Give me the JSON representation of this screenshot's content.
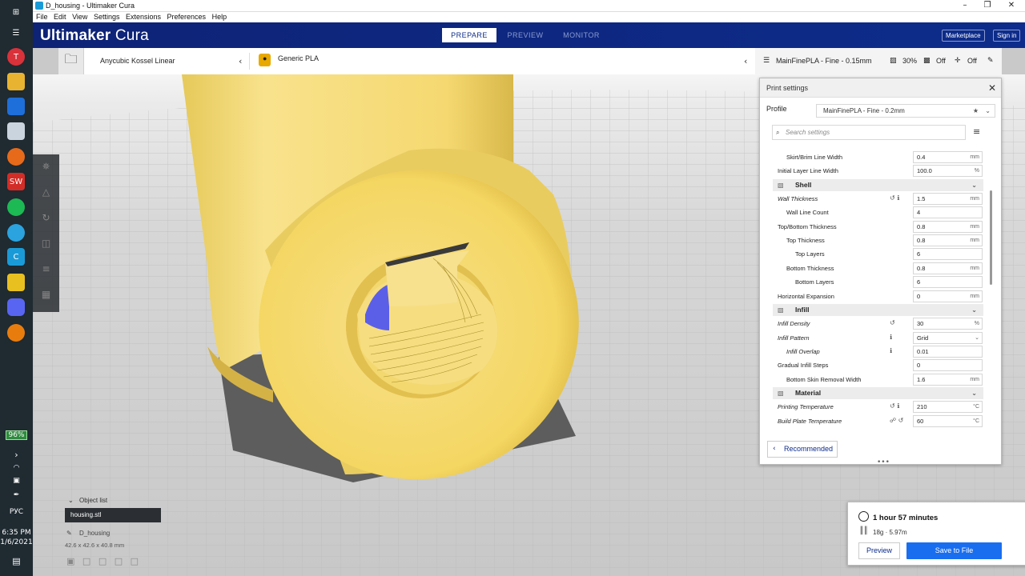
{
  "window": {
    "title": "D_housing - Ultimaker Cura",
    "minimize": "–",
    "maximize": "❐",
    "close": "✕"
  },
  "menubar": [
    "File",
    "Edit",
    "View",
    "Settings",
    "Extensions",
    "Preferences",
    "Help"
  ],
  "header": {
    "brand": "Ultimaker",
    "brand_suffix": "Cura",
    "stages": [
      "PREPARE",
      "PREVIEW",
      "MONITOR"
    ],
    "active_stage": "PREPARE",
    "marketplace": "Marketplace",
    "sign_in": "Sign in"
  },
  "toolbar": {
    "printer": "Anycubic Kossel Linear",
    "material": "Generic PLA",
    "profile_summary": "MainFinePLA - Fine - 0.15mm",
    "infill_pct": "30%",
    "support": "Off",
    "adhesion": "Off"
  },
  "print_settings": {
    "title": "Print settings",
    "profile_label": "Profile",
    "profile_value": "MainFinePLA - Fine - 0.2mm",
    "search_placeholder": "Search settings",
    "rows": [
      {
        "label": "Skirt/Brim Line Width",
        "value": "0.4",
        "unit": "mm",
        "indent": 1,
        "italic": false,
        "icons": ""
      },
      {
        "label": "Initial Layer Line Width",
        "value": "100.0",
        "unit": "%",
        "indent": 0,
        "italic": false,
        "icons": ""
      },
      {
        "category": "Shell"
      },
      {
        "label": "Wall Thickness",
        "value": "1.5",
        "unit": "mm",
        "indent": 0,
        "italic": true,
        "icons": "↺ ℹ"
      },
      {
        "label": "Wall Line Count",
        "value": "4",
        "unit": "",
        "indent": 1,
        "italic": false,
        "icons": ""
      },
      {
        "label": "Top/Bottom Thickness",
        "value": "0.8",
        "unit": "mm",
        "indent": 0,
        "italic": false,
        "icons": ""
      },
      {
        "label": "Top Thickness",
        "value": "0.8",
        "unit": "mm",
        "indent": 1,
        "italic": false,
        "icons": ""
      },
      {
        "label": "Top Layers",
        "value": "6",
        "unit": "",
        "indent": 2,
        "italic": false,
        "icons": ""
      },
      {
        "label": "Bottom Thickness",
        "value": "0.8",
        "unit": "mm",
        "indent": 1,
        "italic": false,
        "icons": ""
      },
      {
        "label": "Bottom Layers",
        "value": "6",
        "unit": "",
        "indent": 2,
        "italic": false,
        "icons": ""
      },
      {
        "label": "Horizontal Expansion",
        "value": "0",
        "unit": "mm",
        "indent": 0,
        "italic": false,
        "icons": ""
      },
      {
        "category": "Infill"
      },
      {
        "label": "Infill Density",
        "value": "30",
        "unit": "%",
        "indent": 0,
        "italic": true,
        "icons": "↺"
      },
      {
        "label": "Infill Pattern",
        "value": "Grid",
        "unit": "⌄",
        "indent": 0,
        "italic": true,
        "icons": "ℹ"
      },
      {
        "label": "Infill Overlap",
        "value": "0.01",
        "unit": "",
        "indent": 1,
        "italic": true,
        "icons": "ℹ"
      },
      {
        "label": "Gradual Infill Steps",
        "value": "0",
        "unit": "",
        "indent": 0,
        "italic": false,
        "icons": ""
      },
      {
        "label": "Bottom Skin Removal Width",
        "value": "1.6",
        "unit": "mm",
        "indent": 1,
        "italic": false,
        "icons": ""
      },
      {
        "category": "Material"
      },
      {
        "label": "Printing Temperature",
        "value": "210",
        "unit": "°C",
        "indent": 0,
        "italic": true,
        "icons": "↺ ℹ"
      },
      {
        "label": "Build Plate Temperature",
        "value": "60",
        "unit": "°C",
        "indent": 0,
        "italic": true,
        "icons": "☍ ↺"
      }
    ],
    "recommended_btn": "Recommended"
  },
  "action_panel": {
    "time": "1 hour 57 minutes",
    "material": "18g · 5.97m",
    "preview_btn": "Preview",
    "save_btn": "Save to File"
  },
  "object_list": {
    "header": "Object list",
    "item": "housing.stl",
    "name": "D_housing",
    "dimensions": "42.6 x 42.6 x 40.8 mm"
  },
  "taskbar": {
    "battery": "96%",
    "lang": "РУС",
    "time": "6:35 PM",
    "date": "1/6/2021"
  },
  "colors": {
    "header_blue": "#0d2c8b",
    "accent_blue": "#196ef0",
    "model_yellow": "#f9dc6b"
  }
}
